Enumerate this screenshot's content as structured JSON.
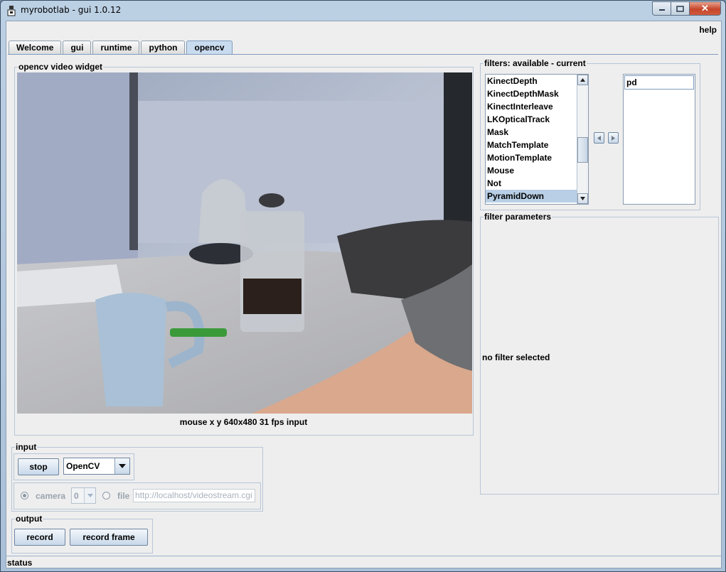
{
  "window": {
    "title": "myrobotlab - gui 1.0.12",
    "buttons": {
      "minimize": "▁",
      "maximize": "☐",
      "close": "✕"
    }
  },
  "menubar": {
    "help": "help"
  },
  "tabs": [
    {
      "label": "Welcome"
    },
    {
      "label": "gui"
    },
    {
      "label": "runtime"
    },
    {
      "label": "python"
    },
    {
      "label": "opencv",
      "active": true
    }
  ],
  "video_widget": {
    "title": "opencv  video widget",
    "caption": "mouse x y  640x480  31 fps  input"
  },
  "filters": {
    "title": "filters: available - current",
    "available": [
      "KinectDepth",
      "KinectDepthMask",
      "KinectInterleave",
      "LKOpticalTrack",
      "Mask",
      "MatchTemplate",
      "MotionTemplate",
      "Mouse",
      "Not",
      "PyramidDown"
    ],
    "selected_available": "PyramidDown",
    "current": [
      "pd"
    ]
  },
  "filter_parameters": {
    "title": "filter parameters",
    "message": "no filter selected"
  },
  "input": {
    "title": "input",
    "stop_label": "stop",
    "source_value": "OpenCV",
    "camera_label": "camera",
    "camera_index": "0",
    "file_label": "file",
    "file_value": "http://localhost/videostream.cgi"
  },
  "output": {
    "title": "output",
    "record_label": "record",
    "record_frame_label": "record frame"
  },
  "status": {
    "label": "status"
  },
  "colors": {
    "accent": "#c9dcef",
    "selection": "#b8cfe5"
  }
}
